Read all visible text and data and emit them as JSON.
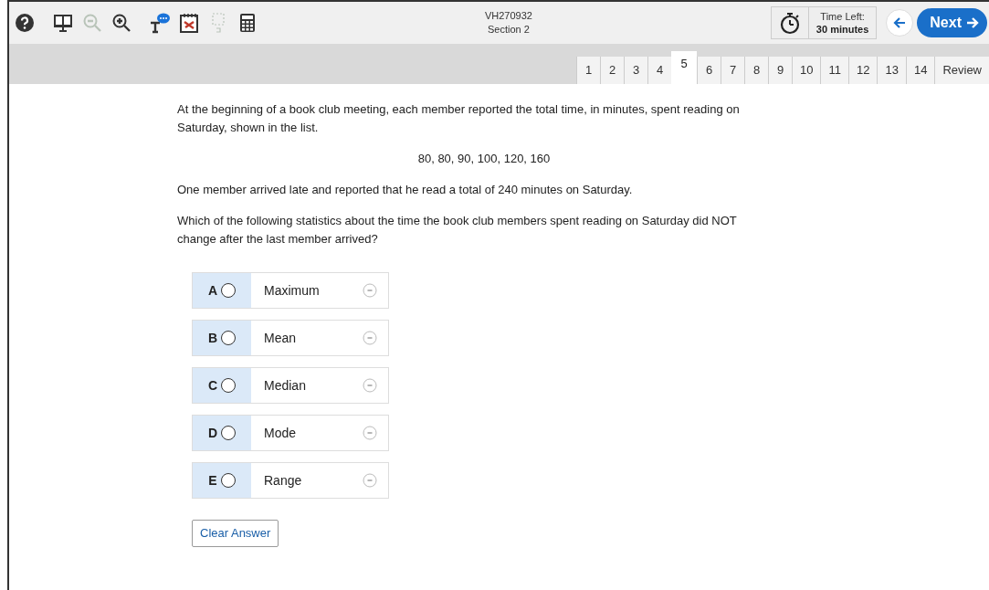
{
  "toolbar": {
    "tools": [
      {
        "kind": "help",
        "disabled": false
      },
      {
        "kind": "reader",
        "disabled": false
      },
      {
        "kind": "zoom-out",
        "disabled": true
      },
      {
        "kind": "zoom-in",
        "disabled": false
      },
      {
        "kind": "speech",
        "disabled": false
      },
      {
        "kind": "eliminator",
        "disabled": false
      },
      {
        "kind": "line-reader",
        "disabled": true
      },
      {
        "kind": "calculator",
        "disabled": false
      }
    ],
    "test_id": "VH270932",
    "section": "Section 2",
    "timer": {
      "label": "Time Left:",
      "value": "30 minutes"
    },
    "next": "Next"
  },
  "tabs": [
    {
      "label": "1",
      "selected": false
    },
    {
      "label": "2",
      "selected": false
    },
    {
      "label": "3",
      "selected": false
    },
    {
      "label": "4",
      "selected": false
    },
    {
      "label": "5",
      "selected": true
    },
    {
      "label": "6",
      "selected": false
    },
    {
      "label": "7",
      "selected": false
    },
    {
      "label": "8",
      "selected": false
    },
    {
      "label": "9",
      "selected": false
    },
    {
      "label": "10",
      "selected": false
    },
    {
      "label": "11",
      "selected": false
    },
    {
      "label": "12",
      "selected": false
    },
    {
      "label": "13",
      "selected": false
    },
    {
      "label": "14",
      "selected": false
    },
    {
      "label": "Review",
      "selected": false
    }
  ],
  "question": {
    "intro": "At the beginning of a book club meeting, each member reported the total time, in minutes, spent reading on Saturday, shown in the list.",
    "list": "80, 80, 90, 100, 120, 160",
    "late": "One member arrived late and reported that he read a total of 240 minutes on Saturday.",
    "prompt": "Which of the following statistics about the time the book club members spent reading on Saturday did NOT change after the last member arrived?"
  },
  "options": [
    {
      "letter": "A",
      "text": "Maximum",
      "selected": false
    },
    {
      "letter": "B",
      "text": "Mean",
      "selected": false
    },
    {
      "letter": "C",
      "text": "Median",
      "selected": false
    },
    {
      "letter": "D",
      "text": "Mode",
      "selected": false
    },
    {
      "letter": "E",
      "text": "Range",
      "selected": false
    }
  ],
  "clear_button": "Clear Answer"
}
